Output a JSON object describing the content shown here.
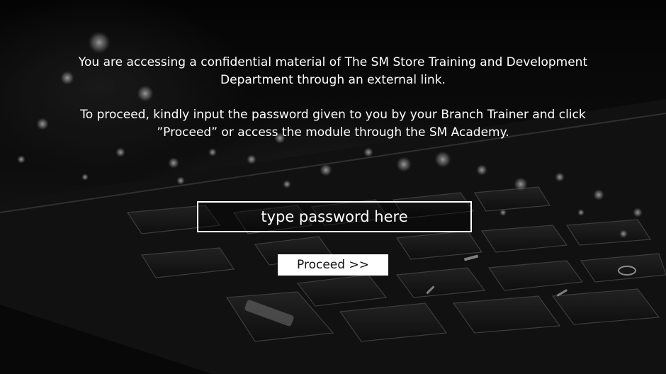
{
  "message": {
    "line1": "You are accessing a confidential material of The SM Store Training and Development Department through an external link.",
    "line2": "To proceed, kindly input the password given to you by your Branch Trainer and click ”Proceed” or access the module through the SM Academy."
  },
  "password": {
    "placeholder": "type password here",
    "value": ""
  },
  "proceed": {
    "label": "Proceed >>"
  },
  "colors": {
    "background": "#000000",
    "text": "#ffffff",
    "button_bg": "#ffffff",
    "button_text": "#111111"
  },
  "background_image": "dark-keyboard-photo"
}
